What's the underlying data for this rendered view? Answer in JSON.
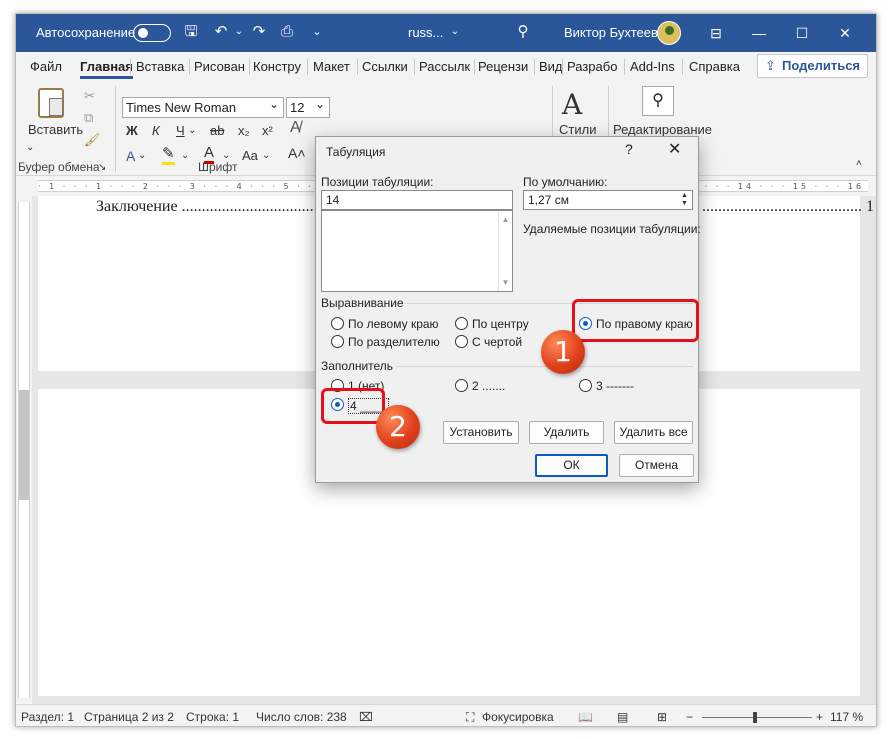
{
  "titlebar": {
    "autosave": "Автосохранение",
    "doc_name": "russ...",
    "user_name": "Виктор Бухтеев"
  },
  "tabs": [
    "Файл",
    "Главная",
    "Вставка",
    "Рисован",
    "Констру",
    "Макет",
    "Ссылки",
    "Рассылк",
    "Рецензи",
    "Вид",
    "Разрабо",
    "Add-Ins",
    "Справка"
  ],
  "share_label": "Поделиться",
  "ribbon": {
    "paste_label": "Вставить",
    "clipboard_label": "Буфер обмена",
    "font_name": "Times New Roman",
    "font_size": "12",
    "font_label": "Шрифт",
    "bold": "Ж",
    "italic": "К",
    "underline": "Ч",
    "strike": "ab",
    "subscript": "x₂",
    "superscript": "x²",
    "case": "Aa",
    "styles_label": "Стили",
    "editing_label": "Редактирование"
  },
  "ruler_text": "· 1 · ⋅ · 1 · ⋅ · 2 · ⋅ · 3 · ⋅ · 4 · ⋅ · 5 · ⋅ · 6 · ⋅ · 7 · ⋅ · 8 · ⋅ · 9 · ⋅ · 10 · ⋅ · 11 · ⋅ · 12 · ⋅ · 13 · ⋅ · 14 · ⋅ · 15 · ⋅ · 16 · ⋅ · 17 · ⋅ · 18",
  "document": {
    "toc_text": "Заключение .......................................",
    "toc_right": "........................................ 1"
  },
  "statusbar": {
    "section": "Раздел: 1",
    "page": "Страница 2 из 2",
    "line": "Строка: 1",
    "words": "Число слов: 238",
    "focus": "Фокусировка",
    "zoom": "117 %"
  },
  "dialog": {
    "title": "Табуляция",
    "help": "?",
    "close": "✕",
    "tab_positions_label": "Позиции табуляции:",
    "tab_positions_value": "14",
    "default_label": "По умолчанию:",
    "default_value": "1,27 см",
    "removed_label": "Удаляемые позиции табуляции:",
    "alignment_label": "Выравнивание",
    "align_left": "По левому краю",
    "align_center": "По центру",
    "align_right": "По правому краю",
    "align_decimal": "По разделителю",
    "align_bar": "С чертой",
    "leader_label": "Заполнитель",
    "leader_1": "1 (нет)",
    "leader_2": "2 .......",
    "leader_3": "3 -------",
    "leader_4": "4 ____",
    "set_button": "Установить",
    "clear_button": "Удалить",
    "clear_all_button": "Удалить все",
    "ok_button": "ОК",
    "cancel_button": "Отмена"
  },
  "annotations": {
    "callout_1": "1",
    "callout_2": "2",
    "highlight_color": "#e60f1c",
    "callout_color": "#e1401d"
  },
  "colors": {
    "titlebar": "#2b579a",
    "accent": "#0a5cc4"
  }
}
